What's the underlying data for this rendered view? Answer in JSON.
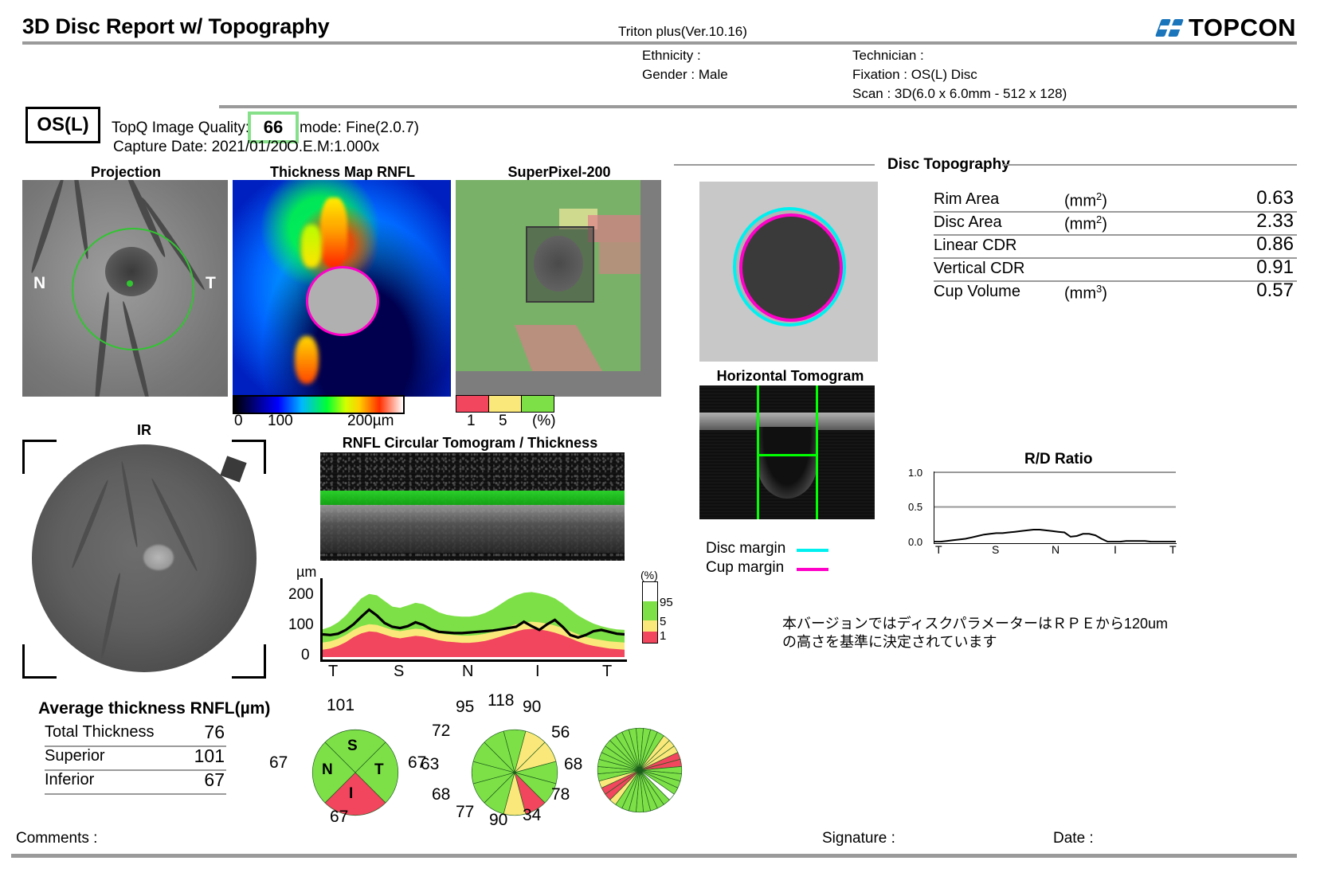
{
  "header": {
    "report_title": "3D Disc Report w/ Topography",
    "device_version": "Triton plus(Ver.10.16)",
    "brand": "TOPCON",
    "ethnicity": "Ethnicity :",
    "gender": "Gender : Male",
    "technician": "Technician :",
    "fixation": "Fixation : OS(L) Disc",
    "scan": "Scan : 3D(6.0 x 6.0mm - 512 x 128)"
  },
  "eye": {
    "laterality": "OS(L)",
    "quality_label": "TopQ Image Quality:",
    "quality_value": "66",
    "mode": "mode: Fine(2.0.7)",
    "capture_date": "Capture Date: 2021/01/20",
    "oem": "O.E.M:1.000x",
    "quality_box_color": "#86e08a"
  },
  "panels": {
    "projection": "Projection",
    "thickness_map": "Thickness Map RNFL",
    "superpixel": "SuperPixel-200",
    "ir": "IR",
    "rnfl_circular": "RNFL Circular Tomogram / Thickness",
    "disc_topography": "Disc Topography",
    "horizontal_tomogram": "Horizontal Tomogram",
    "rd_ratio": "R/D Ratio"
  },
  "projection_labels": {
    "nasal": "N",
    "temporal": "T"
  },
  "thickness_colorbar": {
    "min": "0",
    "mid": "100",
    "max": "200µm"
  },
  "significance_colorbar": {
    "one": "1",
    "five": "5",
    "unit": "(%)",
    "colors": [
      "#f2455e",
      "#fbe87a",
      "#7de047"
    ]
  },
  "disc_topography_table": {
    "rows": [
      {
        "name": "Rim Area",
        "unit_base": "(mm",
        "unit_sup": "2",
        "unit_end": ")",
        "value": "0.63"
      },
      {
        "name": "Disc Area",
        "unit_base": "(mm",
        "unit_sup": "2",
        "unit_end": ")",
        "value": "2.33"
      },
      {
        "name": "Linear CDR",
        "unit_base": "",
        "unit_sup": "",
        "unit_end": "",
        "value": "0.86"
      },
      {
        "name": "Vertical CDR",
        "unit_base": "",
        "unit_sup": "",
        "unit_end": "",
        "value": "0.91"
      },
      {
        "name": "Cup Volume",
        "unit_base": "(mm",
        "unit_sup": "3",
        "unit_end": ")",
        "value": "0.57"
      }
    ]
  },
  "margins_legend": {
    "disc_margin": "Disc margin",
    "disc_color": "#00f0f0",
    "cup_margin": "Cup margin",
    "cup_color": "#ff00c8"
  },
  "average_thickness": {
    "title": "Average thickness RNFL(µm)",
    "rows": [
      {
        "label": "Total Thickness",
        "value": "76"
      },
      {
        "label": "Superior",
        "value": "101"
      },
      {
        "label": "Inferior",
        "value": "67"
      }
    ]
  },
  "note_jp": "本バージョンではディスクパラメーターはＲＰＥから120umの高さを基準に決定されています",
  "footer": {
    "comments": "Comments :",
    "signature": "Signature :",
    "date": "Date :"
  },
  "chart_data": [
    {
      "type": "area",
      "title": "RNFL Circular Tomogram / Thickness",
      "ylabel": "µm",
      "yticks": [
        "0",
        "100",
        "200"
      ],
      "ylim": [
        0,
        250
      ],
      "xticks": [
        "T",
        "S",
        "N",
        "I",
        "T"
      ],
      "legend": {
        "unit": "(%)",
        "entries": [
          "95",
          "5",
          "1"
        ],
        "colors": [
          "#ffffff",
          "#7de047",
          "#fbe87a",
          "#f2455e"
        ]
      },
      "series": [
        {
          "name": "RNFL thickness",
          "values": [
            72,
            70,
            74,
            86,
            104,
            128,
            150,
            132,
            108,
            96,
            92,
            98,
            110,
            102,
            88,
            80,
            78,
            76,
            76,
            78,
            80,
            82,
            84,
            88,
            92,
            96,
            112,
            98,
            86,
            104,
            118,
            96,
            70,
            62,
            70,
            82,
            86,
            80,
            74,
            72
          ]
        },
        {
          "name": "normative-95-upper",
          "values": [
            88,
            96,
            110,
            132,
            160,
            186,
            200,
            196,
            178,
            160,
            156,
            164,
            172,
            168,
            156,
            142,
            134,
            130,
            128,
            128,
            132,
            140,
            152,
            168,
            184,
            196,
            204,
            206,
            202,
            196,
            186,
            170,
            150,
            132,
            118,
            106,
            98,
            92,
            88,
            86
          ]
        },
        {
          "name": "normative-5-lower",
          "values": [
            46,
            50,
            58,
            70,
            86,
            98,
            104,
            102,
            94,
            86,
            82,
            86,
            90,
            88,
            82,
            76,
            72,
            70,
            68,
            68,
            70,
            74,
            80,
            88,
            96,
            104,
            110,
            112,
            110,
            106,
            100,
            92,
            82,
            72,
            64,
            58,
            54,
            50,
            48,
            46
          ]
        }
      ]
    },
    {
      "type": "line",
      "title": "R/D Ratio",
      "yticks": [
        "0.0",
        "0.5",
        "1.0"
      ],
      "ylim": [
        0,
        1
      ],
      "xticks": [
        "T",
        "S",
        "N",
        "I",
        "T"
      ],
      "values": [
        0.01,
        0.01,
        0.02,
        0.03,
        0.04,
        0.05,
        0.07,
        0.09,
        0.11,
        0.12,
        0.13,
        0.13,
        0.14,
        0.15,
        0.16,
        0.17,
        0.18,
        0.18,
        0.17,
        0.16,
        0.15,
        0.14,
        0.08,
        0.09,
        0.12,
        0.12,
        0.1,
        0.05,
        0.01,
        0.01,
        0.01,
        0.02,
        0.02,
        0.02,
        0.02,
        0.01,
        0.01,
        0.01,
        0.01,
        0.01
      ]
    },
    {
      "type": "pie",
      "name": "quadrant-pie",
      "sectors": [
        {
          "label": "S",
          "value": "101",
          "color": "#7de047",
          "pos": "top"
        },
        {
          "label": "T",
          "value": "67",
          "color": "#7de047",
          "pos": "right"
        },
        {
          "label": "I",
          "value": "67",
          "color": "#f2455e",
          "pos": "bottom"
        },
        {
          "label": "N",
          "value": "67",
          "color": "#7de047",
          "pos": "left"
        }
      ]
    },
    {
      "type": "pie",
      "name": "clock-12-pie",
      "values": [
        "118",
        "90",
        "56",
        "68",
        "78",
        "34",
        "90",
        "77",
        "68",
        "63",
        "72",
        "95"
      ],
      "colors": [
        "#7de047",
        "#fbe87a",
        "#fbe87a",
        "#7de047",
        "#7de047",
        "#f2455e",
        "#fbe87a",
        "#7de047",
        "#7de047",
        "#7de047",
        "#7de047",
        "#7de047"
      ]
    },
    {
      "type": "pie",
      "name": "clock-36-pie",
      "colors": [
        "#7de047",
        "#7de047",
        "#7de047",
        "#7de047",
        "#fbe87a",
        "#fbe87a",
        "#fbe87a",
        "#f2455e",
        "#f2455e",
        "#7de047",
        "#7de047",
        "#7de047",
        "#7de047",
        "#ffffff",
        "#7de047",
        "#7de047",
        "#7de047",
        "#7de047",
        "#7de047",
        "#7de047",
        "#7de047",
        "#7de047",
        "#fbe87a",
        "#f2455e",
        "#f2455e",
        "#fbe87a",
        "#7de047",
        "#7de047",
        "#7de047",
        "#7de047",
        "#7de047",
        "#7de047",
        "#7de047",
        "#7de047",
        "#7de047",
        "#7de047"
      ]
    }
  ]
}
